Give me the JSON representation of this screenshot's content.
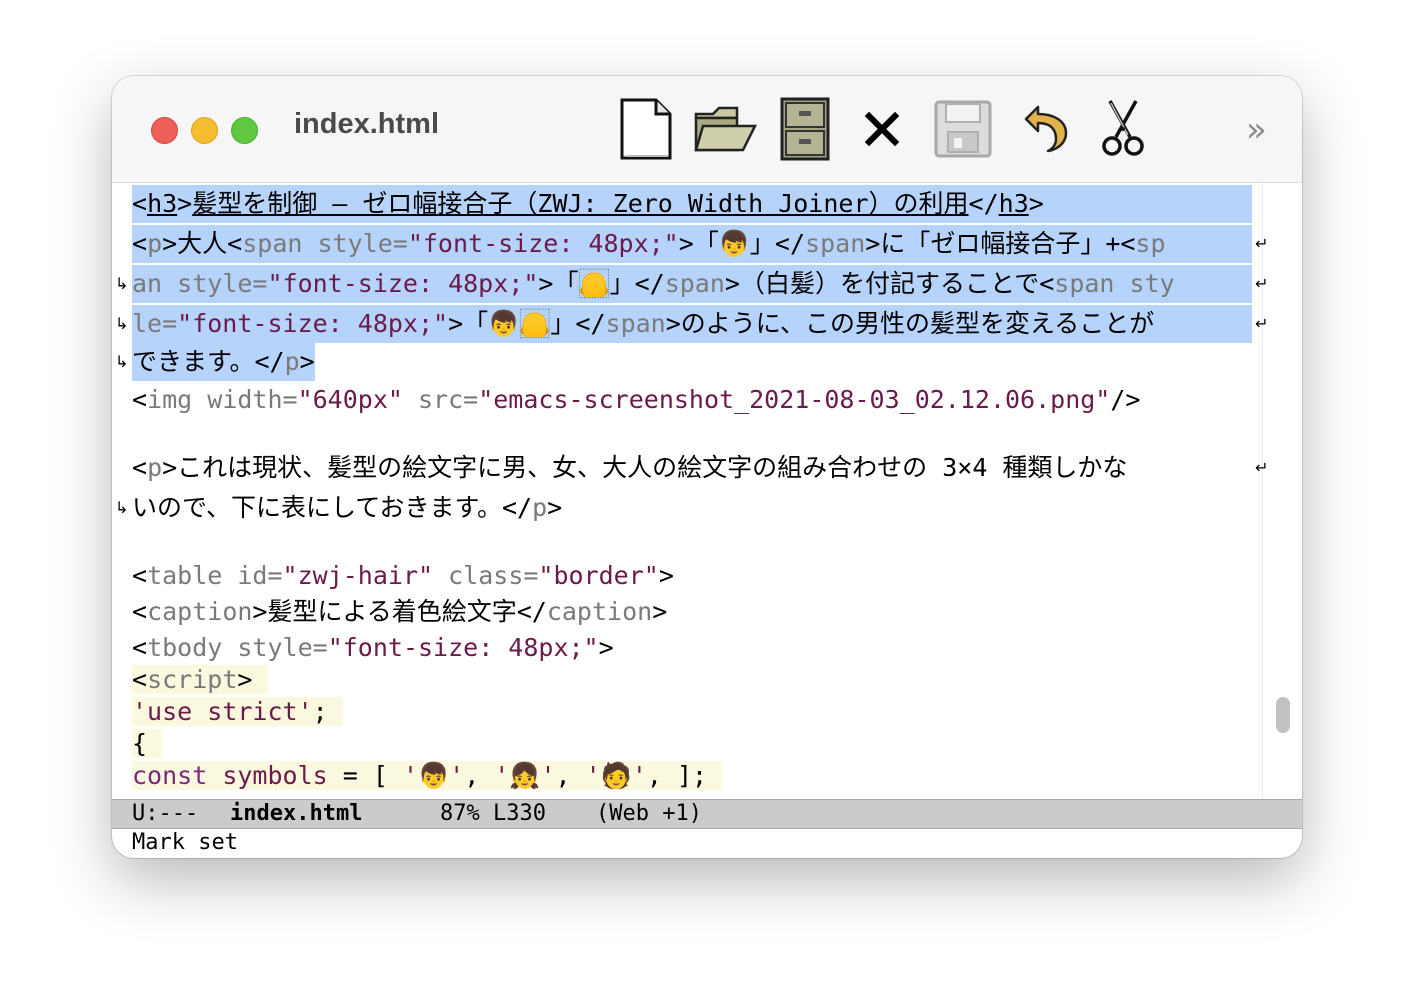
{
  "window": {
    "title": "index.html"
  },
  "toolbar": {
    "icons": [
      "new-file-icon",
      "open-folder-icon",
      "cabinet-icon",
      "close-x-icon",
      "save-disk-icon",
      "undo-icon",
      "cut-scissors-icon"
    ],
    "overflow": "»"
  },
  "buffer": {
    "l1": {
      "open": "<",
      "tag": "h3",
      "close": ">",
      "text": "髪型を制御 ― ゼロ幅接合子（ZWJ: Zero Width Joiner）の利用",
      "end_open": "</",
      "end_tag": "h3",
      "end_close": ">"
    },
    "l2": {
      "a": "<",
      "b": "p",
      "c": ">大人<",
      "d": "span",
      "e": " style=",
      "f": "\"font-size: 48px;\"",
      "g": ">「👦」</",
      "h": "span",
      "i": ">に「ゼロ幅接合子」+<",
      "j": "sp"
    },
    "l3": {
      "a": "an",
      "b": " style=",
      "c": "\"font-size: 48px;\"",
      "d": ">「🦲」</",
      "e": "span",
      "f": ">（白髪）を付記することで<",
      "g": "span",
      "h": " sty"
    },
    "l4": {
      "a": "le=",
      "b": "\"font-size: 48px;\"",
      "c": ">「👦🦲」</",
      "d": "span",
      "e": ">のように、この男性の髪型を変えることが"
    },
    "l5": {
      "a": "できます。</",
      "b": "p",
      "c": ">"
    },
    "l6": {
      "a": "<",
      "b": "img",
      "c": " width=",
      "d": "\"640px\"",
      "e": " src=",
      "f": "\"emacs-screenshot_2021-08-03_02.12.06.png\"",
      "g": "/>"
    },
    "l7": {
      "a": "<",
      "b": "p",
      "c": ">これは現状、髪型の絵文字に男、女、大人の絵文字の組み合わせの 3×4 種類しかな"
    },
    "l8": {
      "a": "いので、下に表にしておきます。</",
      "b": "p",
      "c": ">"
    },
    "l9": {
      "a": "<",
      "b": "table",
      "c": " id=",
      "d": "\"zwj-hair\"",
      "e": " class=",
      "f": "\"border\"",
      "g": ">"
    },
    "l10": {
      "a": "<",
      "b": "caption",
      "c": ">髪型による着色絵文字</",
      "d": "caption",
      "e": ">"
    },
    "l11": {
      "a": "<",
      "b": "tbody",
      "c": " style=",
      "d": "\"font-size: 48px;\"",
      "e": ">"
    },
    "l12": {
      "a": "<",
      "b": "script",
      "c": ">"
    },
    "l13": {
      "a": "'use strict'",
      "b": ";"
    },
    "l14": {
      "a": "{"
    },
    "l15": {
      "a": "const",
      "b": " ",
      "c": "symbols",
      "d": " = [ ",
      "e": "'👦'",
      "f": ", ",
      "g": "'👧'",
      "h": ", ",
      "i": "'🧑'",
      "j": ", ];"
    }
  },
  "wrap_arrows": {
    "right": "↵",
    "left": "↳"
  },
  "modeline": {
    "state": "U:---",
    "buffer_name": "index.html",
    "position": "87% L330",
    "mode": "(Web +1)"
  },
  "echo_area": {
    "message": "Mark set"
  }
}
